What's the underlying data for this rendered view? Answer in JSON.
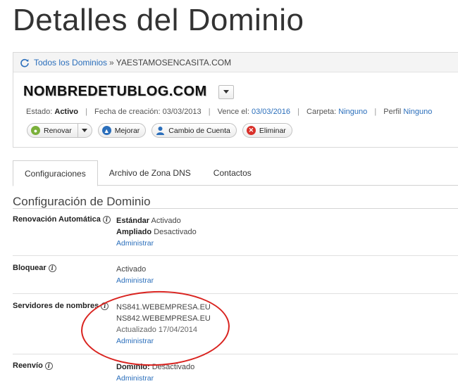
{
  "page": {
    "title": "Detalles del Dominio"
  },
  "breadcrumb": {
    "all_domains": "Todos los Dominios",
    "separator": "»",
    "current": "YAESTAMOSENCASITA.COM"
  },
  "domain": {
    "name": "NOMBREDETUBLOG.COM",
    "status_label": "Estado:",
    "status_value": "Activo",
    "created_label": "Fecha de creación:",
    "created_value": "03/03/2013",
    "expires_label": "Vence el:",
    "expires_value": "03/03/2016",
    "folder_label": "Carpeta:",
    "folder_value": "Ninguno",
    "profile_label": "Perfil",
    "profile_value": "Ninguno"
  },
  "actions": {
    "renew": "Renovar",
    "upgrade": "Mejorar",
    "change_account": "Cambio de Cuenta",
    "delete": "Eliminar"
  },
  "tabs": [
    {
      "label": "Configuraciones",
      "active": true
    },
    {
      "label": "Archivo de Zona DNS",
      "active": false
    },
    {
      "label": "Contactos",
      "active": false
    }
  ],
  "settings": {
    "section_title": "Configuración de Dominio",
    "auto_renew": {
      "label": "Renovación Automática",
      "standard_label": "Estándar",
      "standard_value": "Activado",
      "extended_label": "Ampliado",
      "extended_value": "Desactivado",
      "manage": "Administrar"
    },
    "lock": {
      "label": "Bloquear",
      "value": "Activado",
      "manage": "Administrar"
    },
    "nameservers": {
      "label": "Servidores de nombres",
      "ns1": "NS841.WEBEMPRESA.EU",
      "ns2": "NS842.WEBEMPRESA.EU",
      "updated": "Actualizado 17/04/2014",
      "manage": "Administrar"
    },
    "forwarding": {
      "label": "Reenvío",
      "domain_label": "Dominio:",
      "domain_value": "Desactivado",
      "manage": "Administrar"
    }
  },
  "colors": {
    "link": "#2a6ebb",
    "highlight": "#d9231f",
    "renew_icon": "#7ab03a",
    "upgrade_icon": "#2a6ebb",
    "account_icon": "#2a6ebb",
    "delete_icon": "#d9302a"
  },
  "icons": {
    "refresh": "refresh-icon",
    "info": "info-icon",
    "caret": "chevron-down-icon"
  }
}
